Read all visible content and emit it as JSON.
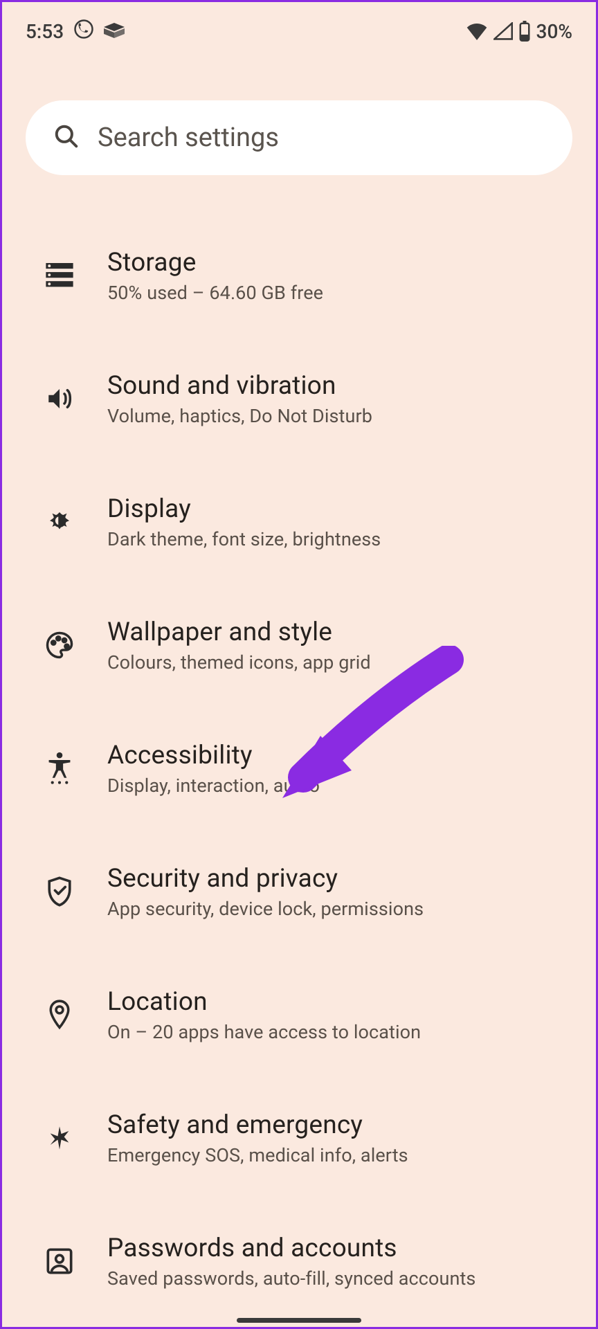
{
  "status": {
    "time": "5:53",
    "battery_text": "30%"
  },
  "search": {
    "placeholder": "Search settings"
  },
  "items": [
    {
      "title": "Storage",
      "subtitle": "50% used – 64.60 GB free"
    },
    {
      "title": "Sound and vibration",
      "subtitle": "Volume, haptics, Do Not Disturb"
    },
    {
      "title": "Display",
      "subtitle": "Dark theme, font size, brightness"
    },
    {
      "title": "Wallpaper and style",
      "subtitle": "Colours, themed icons, app grid"
    },
    {
      "title": "Accessibility",
      "subtitle": "Display, interaction, audio"
    },
    {
      "title": "Security and privacy",
      "subtitle": "App security, device lock, permissions"
    },
    {
      "title": "Location",
      "subtitle": "On – 20 apps have access to location"
    },
    {
      "title": "Safety and emergency",
      "subtitle": "Emergency SOS, medical info, alerts"
    },
    {
      "title": "Passwords and accounts",
      "subtitle": "Saved passwords, auto-fill, synced accounts"
    }
  ],
  "annotation": {
    "arrow_color": "#8a2be2"
  }
}
